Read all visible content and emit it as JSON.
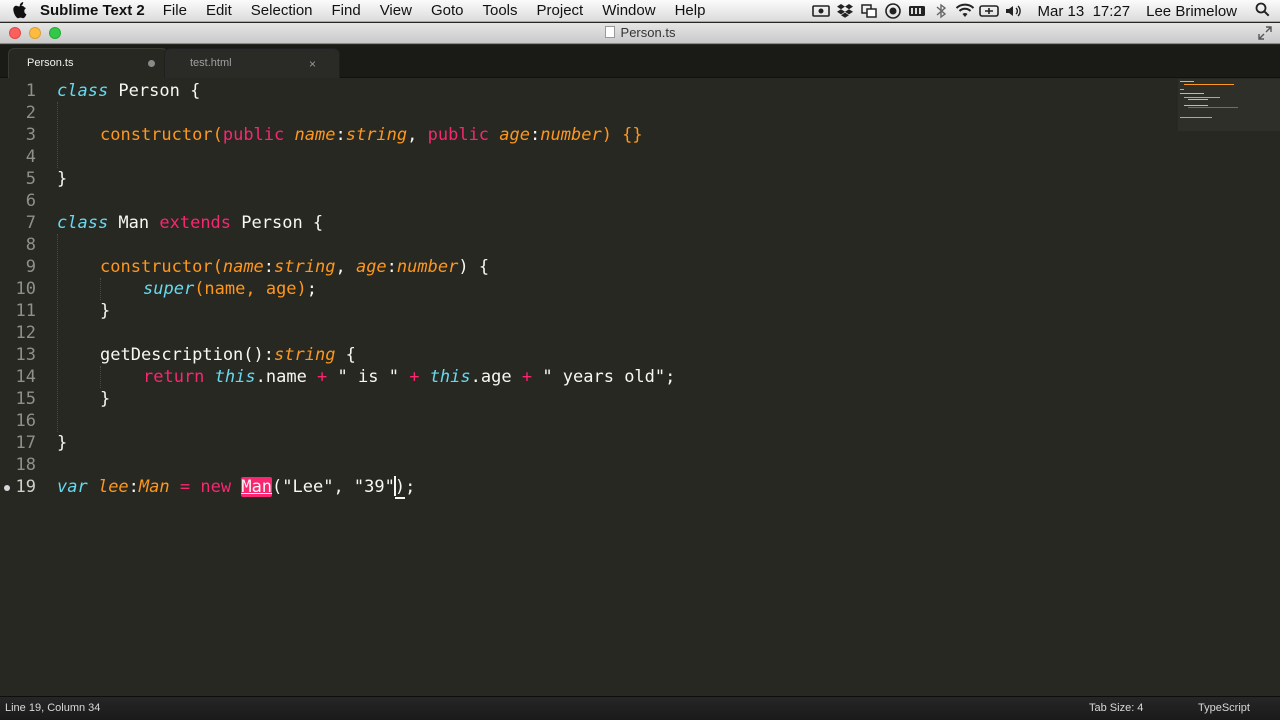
{
  "menubar": {
    "app": "Sublime Text 2",
    "items": [
      "File",
      "Edit",
      "Selection",
      "Find",
      "View",
      "Goto",
      "Tools",
      "Project",
      "Window",
      "Help"
    ],
    "tray_icons": [
      "screen-record-icon",
      "dropbox-icon",
      "window-icon",
      "circle-icon",
      "battery-icon",
      "bluetooth-icon",
      "wifi-icon",
      "time-machine-icon",
      "volume-icon"
    ],
    "date": "Mar 13",
    "time": "17:27",
    "user": "Lee Brimelow"
  },
  "window": {
    "title": "Person.ts"
  },
  "tabs": [
    {
      "label": "Person.ts",
      "active": true,
      "control": "dirty-dot"
    },
    {
      "label": "test.html",
      "active": false,
      "control": "×"
    }
  ],
  "editor": {
    "line_numbers": [
      "1",
      "2",
      "3",
      "4",
      "5",
      "6",
      "7",
      "8",
      "9",
      "10",
      "11",
      "12",
      "13",
      "14",
      "15",
      "16",
      "17",
      "18",
      "19"
    ],
    "current_line": "19",
    "code": {
      "l1": {
        "kw": "class",
        "name": " Person {"
      },
      "l3": {
        "ctor": "constructor",
        "open": "(",
        "pub1": "public",
        "p1": "name",
        "colon1": ":",
        "t1": "string",
        "comma1": ", ",
        "pub2": "public",
        "p2": "age",
        "colon2": ":",
        "t2": "number",
        "close": ") {}"
      },
      "l5": {
        "text": "}"
      },
      "l7": {
        "kw": "class",
        "name": " Man ",
        "ext": "extends",
        "rest": " Person {"
      },
      "l9": {
        "ctor": "constructor",
        "open": "(",
        "p1": "name",
        "colon1": ":",
        "t1": "string",
        "comma1": ", ",
        "p2": "age",
        "colon2": ":",
        "t2": "number",
        "close": ") {"
      },
      "l10": {
        "sup": "super",
        "args": "(name, age)",
        "end": ";"
      },
      "l11": {
        "text": "}"
      },
      "l13": {
        "name": "getDescription()",
        "colon": ":",
        "type": "string",
        "rest": " {"
      },
      "l14": {
        "ret": "return",
        "this1": "this",
        "prop1": ".name ",
        "plus1": "+",
        "s1": " \" is \" ",
        "plus2": "+",
        "this2": "this",
        "prop2": ".age ",
        "plus3": "+",
        "s2": " \" years old\"",
        "end": ";"
      },
      "l15": {
        "text": "}"
      },
      "l17": {
        "text": "}"
      },
      "l19": {
        "var": "var",
        "ident": " lee",
        "colon": ":",
        "type": "Man",
        "eq": " = ",
        "new": "new",
        "sp": " ",
        "cls": "Man",
        "args": "(\"Lee\", \"39\"",
        "close": ")",
        "end": ";"
      }
    }
  },
  "statusbar": {
    "position": "Line 19, Column 34",
    "tab_size": "Tab Size: 4",
    "syntax": "TypeScript"
  },
  "colors": {
    "background": "#272822",
    "keyword": "#f92672",
    "storage": "#66d9ef",
    "function": "#fd971f",
    "text": "#f8f8f2"
  }
}
